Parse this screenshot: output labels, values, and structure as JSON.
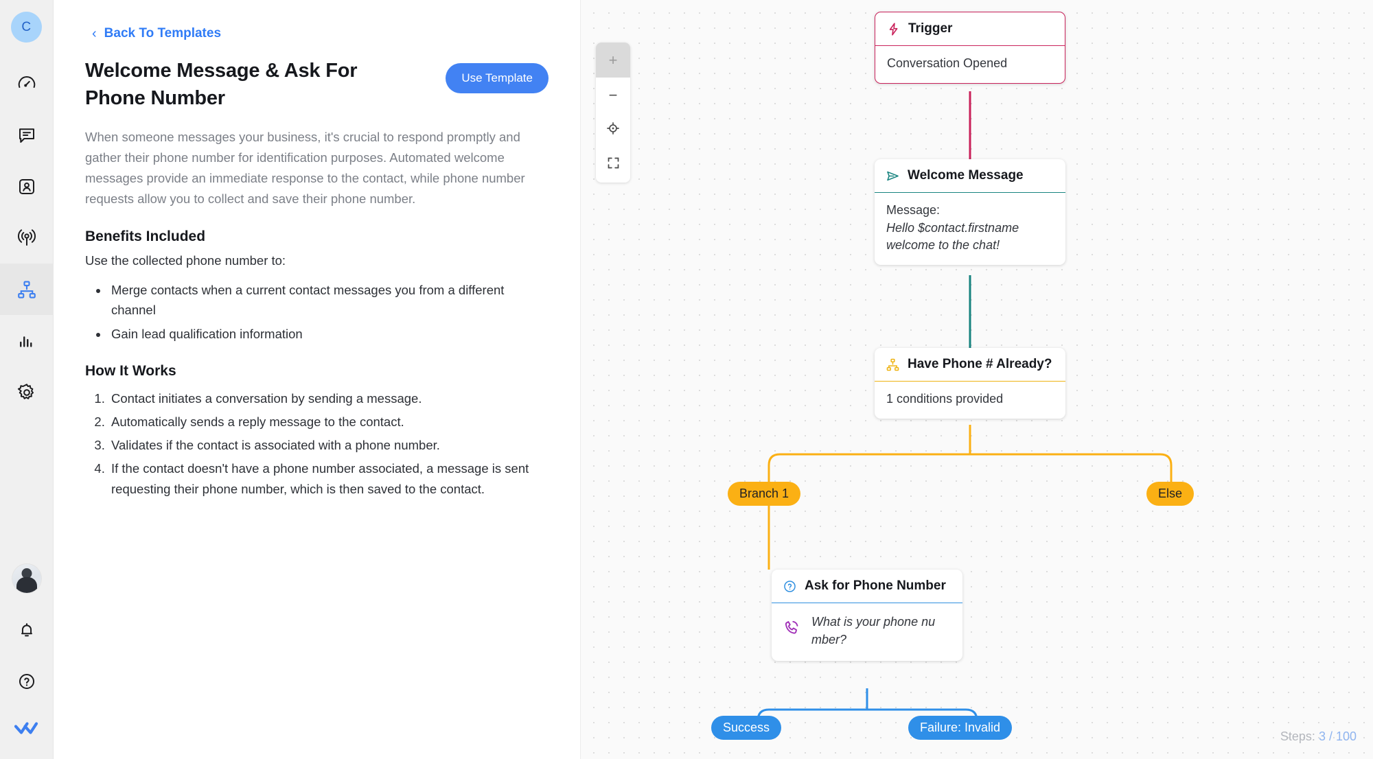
{
  "rail": {
    "avatar_initial": "C",
    "items": [
      {
        "name": "dashboard",
        "icon": "gauge-icon",
        "active": false
      },
      {
        "name": "inbox",
        "icon": "chat-bubble-icon",
        "active": false
      },
      {
        "name": "contacts",
        "icon": "contact-card-icon",
        "active": false
      },
      {
        "name": "broadcast",
        "icon": "broadcast-icon",
        "active": false
      },
      {
        "name": "automations",
        "icon": "flow-nodes-icon",
        "active": true
      },
      {
        "name": "reports",
        "icon": "bar-chart-icon",
        "active": false
      },
      {
        "name": "settings",
        "icon": "gear-icon",
        "active": false
      }
    ],
    "bottom": [
      {
        "name": "user-avatar",
        "icon": "user-photo-icon"
      },
      {
        "name": "notifications",
        "icon": "bell-icon"
      },
      {
        "name": "help",
        "icon": "question-circle-icon"
      },
      {
        "name": "brand",
        "icon": "double-check-logo-icon"
      }
    ]
  },
  "detail": {
    "back_label": "Back To Templates",
    "back_chevron": "‹",
    "title": "Welcome Message & Ask For Phone Number",
    "use_template_label": "Use Template",
    "intro": "When someone messages your business, it's crucial to respond promptly and gather their phone number for identification purposes. Automated welcome messages provide an immediate response to the contact, while phone number requests allow you to collect and save their phone number.",
    "benefits_heading": "Benefits Included",
    "benefits_sub": "Use the collected phone number to:",
    "benefits": [
      "Merge contacts when a current contact messages you from a different channel",
      "Gain lead qualification information"
    ],
    "how_heading": "How It Works",
    "how_steps": [
      "Contact initiates a conversation by sending a message.",
      "Automatically sends a reply message to the contact.",
      "Validates if the contact is associated with a phone number.",
      "If the contact doesn't have a phone number associated, a message is sent requesting their phone number, which is then saved to the contact."
    ]
  },
  "canvas": {
    "zoom_controls": [
      {
        "name": "zoom-in",
        "glyph": "+",
        "disabled": true
      },
      {
        "name": "zoom-out",
        "glyph": "−",
        "disabled": false
      },
      {
        "name": "fit-view",
        "glyph": "crosshair-icon",
        "disabled": false
      },
      {
        "name": "fullscreen",
        "glyph": "expand-icon",
        "disabled": false
      }
    ],
    "steps_label": "Steps:",
    "steps_value": "3 / 100",
    "nodes": {
      "trigger": {
        "title": "Trigger",
        "icon": "lightning-bolt-icon",
        "body": "Conversation Opened",
        "accent": "#c9215a"
      },
      "welcome": {
        "title": "Welcome Message",
        "icon": "send-arrow-icon",
        "label": "Message:",
        "text": "Hello $contact.firstname welcome to the chat!",
        "accent": "#17837f"
      },
      "condition": {
        "title": "Have Phone # Already?",
        "icon": "branch-nodes-icon",
        "body": "1 conditions provided",
        "accent": "#eeb211"
      },
      "ask": {
        "title": "Ask for Phone Number",
        "icon": "question-circle-icon",
        "body_icon": "phone-icon",
        "text": "What is your phone nu mber?",
        "accent": "#2f8fe0"
      }
    },
    "pills": [
      {
        "name": "branch-1",
        "label": "Branch 1",
        "style": "amber"
      },
      {
        "name": "else",
        "label": "Else",
        "style": "amber"
      },
      {
        "name": "success",
        "label": "Success",
        "style": "blue"
      },
      {
        "name": "failure-invalid",
        "label": "Failure: Invalid",
        "style": "blue"
      }
    ]
  },
  "colors": {
    "brand_blue": "#4282f3",
    "trigger_crimson": "#c9215a",
    "message_teal": "#17837f",
    "condition_amber": "#eeb211",
    "ask_blue": "#2f8fe0",
    "pill_amber": "#fbb014",
    "pill_blue": "#2f8fe8"
  }
}
